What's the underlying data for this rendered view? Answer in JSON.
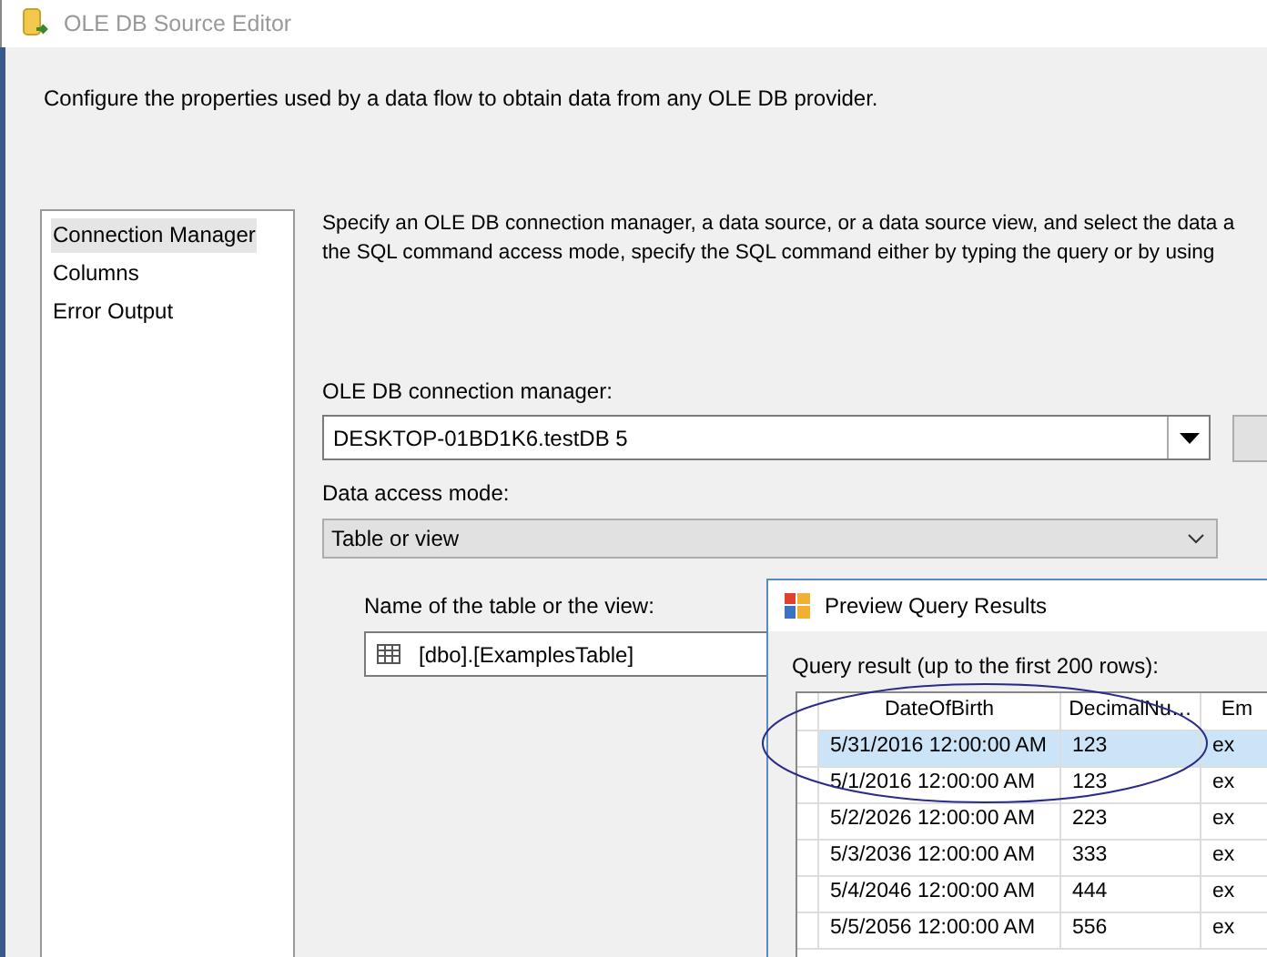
{
  "window": {
    "title": "OLE DB Source Editor"
  },
  "description": "Configure the properties used by a data flow to obtain data from any OLE DB provider.",
  "sidebar": {
    "items": [
      {
        "label": "Connection Manager",
        "selected": true
      },
      {
        "label": "Columns",
        "selected": false
      },
      {
        "label": "Error Output",
        "selected": false
      }
    ]
  },
  "instructions": [
    "Specify an OLE DB connection manager, a data source, or a data source view, and select the data a",
    "the SQL command access mode, specify the SQL command either by typing the query or by using"
  ],
  "connection_manager": {
    "label": "OLE DB connection manager:",
    "value": "DESKTOP-01BD1K6.testDB 5"
  },
  "data_access_mode": {
    "label": "Data access mode:",
    "value": "Table or view"
  },
  "table_name": {
    "label": "Name of the table or the view:",
    "value": "[dbo].[ExamplesTable]"
  },
  "preview_dialog": {
    "title": "Preview Query Results",
    "caption": "Query result (up to the first 200 rows):",
    "columns": [
      "DateOfBirth",
      "DecimalNu…",
      "Em"
    ],
    "rows": [
      {
        "cells": [
          "5/31/2016 12:00:00 AM",
          "123",
          "ex"
        ],
        "selected": true
      },
      {
        "cells": [
          "5/1/2016 12:00:00 AM",
          "123",
          "ex"
        ],
        "selected": false
      },
      {
        "cells": [
          "5/2/2026 12:00:00 AM",
          "223",
          "ex"
        ],
        "selected": false
      },
      {
        "cells": [
          "5/3/2036 12:00:00 AM",
          "333",
          "ex"
        ],
        "selected": false
      },
      {
        "cells": [
          "5/4/2046 12:00:00 AM",
          "444",
          "ex"
        ],
        "selected": false
      },
      {
        "cells": [
          "5/5/2056 12:00:00 AM",
          "556",
          "ex"
        ],
        "selected": false
      }
    ]
  }
}
